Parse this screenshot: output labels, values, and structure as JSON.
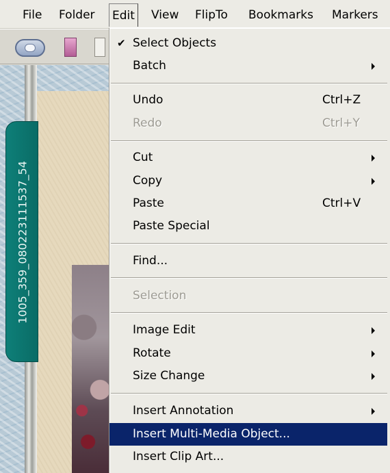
{
  "menubar": {
    "items": [
      "File",
      "Folder",
      "Edit",
      "View",
      "FlipTo",
      "Bookmarks",
      "Markers"
    ]
  },
  "toolbar": {
    "icons": [
      "navigate-oval-icon",
      "pink-page-icon",
      "blank-page-icon"
    ]
  },
  "side_tab": {
    "label": "1005_359_0802231115​37_54"
  },
  "edit_menu": {
    "items": [
      {
        "label": "Select Objects",
        "checked": true
      },
      {
        "label": "Batch",
        "submenu": true
      },
      {
        "label": "Undo",
        "shortcut": "Ctrl+Z"
      },
      {
        "label": "Redo",
        "shortcut": "Ctrl+Y",
        "disabled": true
      },
      {
        "label": "Cut",
        "submenu": true
      },
      {
        "label": "Copy",
        "submenu": true
      },
      {
        "label": "Paste",
        "shortcut": "Ctrl+V"
      },
      {
        "label": "Paste Special"
      },
      {
        "label": "Find..."
      },
      {
        "label": "Selection",
        "disabled": true
      },
      {
        "label": "Image Edit",
        "submenu": true
      },
      {
        "label": "Rotate",
        "submenu": true
      },
      {
        "label": "Size Change",
        "submenu": true
      },
      {
        "label": "Insert Annotation",
        "submenu": true
      },
      {
        "label": "Insert Multi-Media Object...",
        "highlighted": true
      },
      {
        "label": "Insert Clip Art..."
      }
    ]
  },
  "colors": {
    "menu_highlight": "#0a246a",
    "side_tab": "#0e7f78",
    "menu_background": "#ecebe5"
  }
}
